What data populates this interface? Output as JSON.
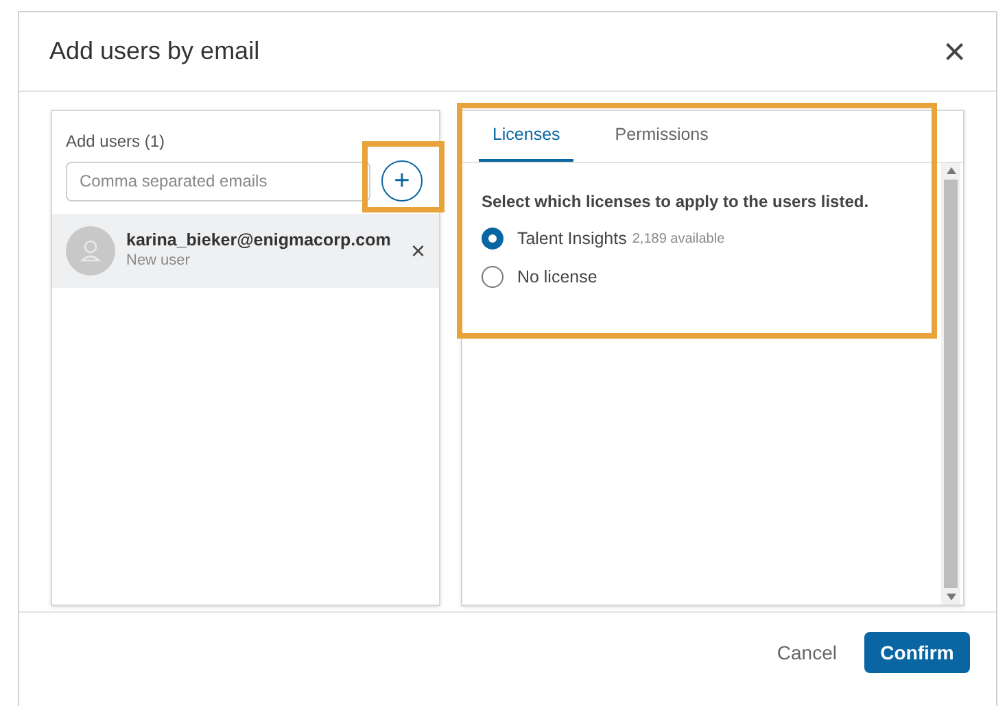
{
  "dialog": {
    "title": "Add users by email",
    "close": "×"
  },
  "users_panel": {
    "label": "Add users (1)",
    "email_field": {
      "placeholder": "Comma separated emails"
    },
    "add": "+",
    "users": [
      {
        "email": "karina_bieker@enigmacorp.com",
        "subtitle": "New user",
        "remove": "×"
      }
    ]
  },
  "tabs": [
    {
      "label": "Licenses",
      "selected": true
    },
    {
      "label": "Permissions",
      "selected": false
    }
  ],
  "licenses": {
    "instruction": "Select which licenses to apply to the users listed.",
    "options": [
      {
        "label": "Talent Insights",
        "note": "2,189 available",
        "selected": true
      },
      {
        "label": "No license",
        "selected": false
      }
    ]
  },
  "highlights": {
    "add_button": true,
    "licenses_panel": true
  },
  "buttons": {
    "cancel": "Cancel",
    "confirm": "Confirm"
  }
}
